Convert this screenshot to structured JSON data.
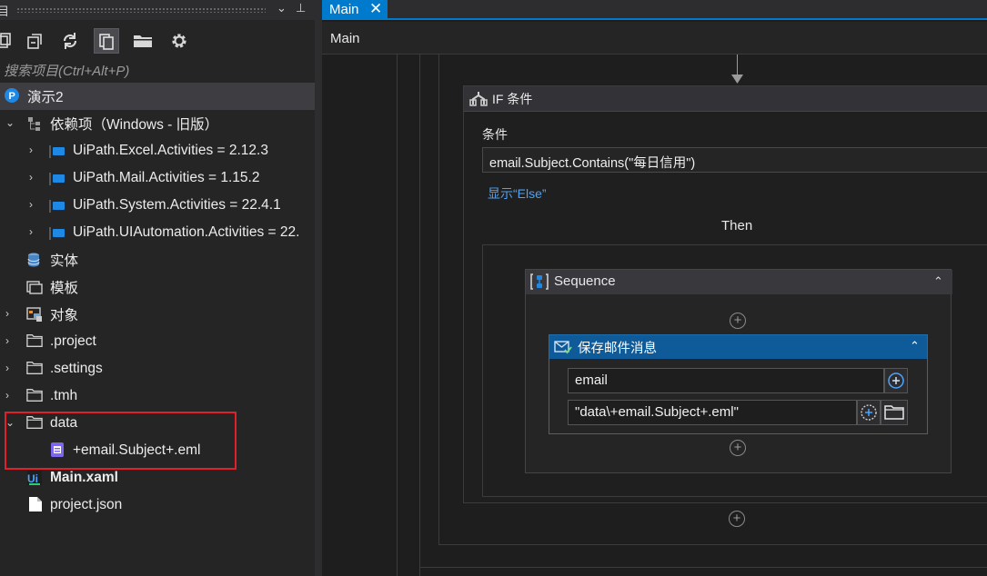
{
  "left_panel": {
    "title": "目",
    "search_placeholder": "搜索项目(Ctrl+Alt+P)",
    "tree": {
      "project": "演示2",
      "dependencies": "依赖项（Windows - 旧版）",
      "packages": [
        "UiPath.Excel.Activities = 2.12.3",
        "UiPath.Mail.Activities = 1.15.2",
        "UiPath.System.Activities = 22.4.1",
        "UiPath.UIAutomation.Activities = 22."
      ],
      "entities": "实体",
      "templates": "模板",
      "objects": "对象",
      "folders": [
        ".project",
        ".settings",
        ".tmh"
      ],
      "data_folder": "data",
      "data_file": "+email.Subject+.eml",
      "main_xaml": "Main.xaml",
      "project_json": "project.json"
    }
  },
  "right_panel": {
    "tab_label": "Main",
    "tab_close": "✕",
    "breadcrumb": "Main",
    "if_activity": {
      "title": "IF 条件",
      "condition_label": "条件",
      "condition_value": "email.Subject.Contains(\"每日信用\")",
      "show_else": "显示“Else”",
      "then_label": "Then"
    },
    "sequence": {
      "title": "Sequence"
    },
    "save_mail": {
      "title": "保存邮件消息",
      "email_value": "email",
      "path_value": "\"data\\+email.Subject+.eml\""
    }
  },
  "colors": {
    "accent": "#007acc",
    "highlight_box": "#e0202a",
    "link": "#4ea1f3"
  }
}
